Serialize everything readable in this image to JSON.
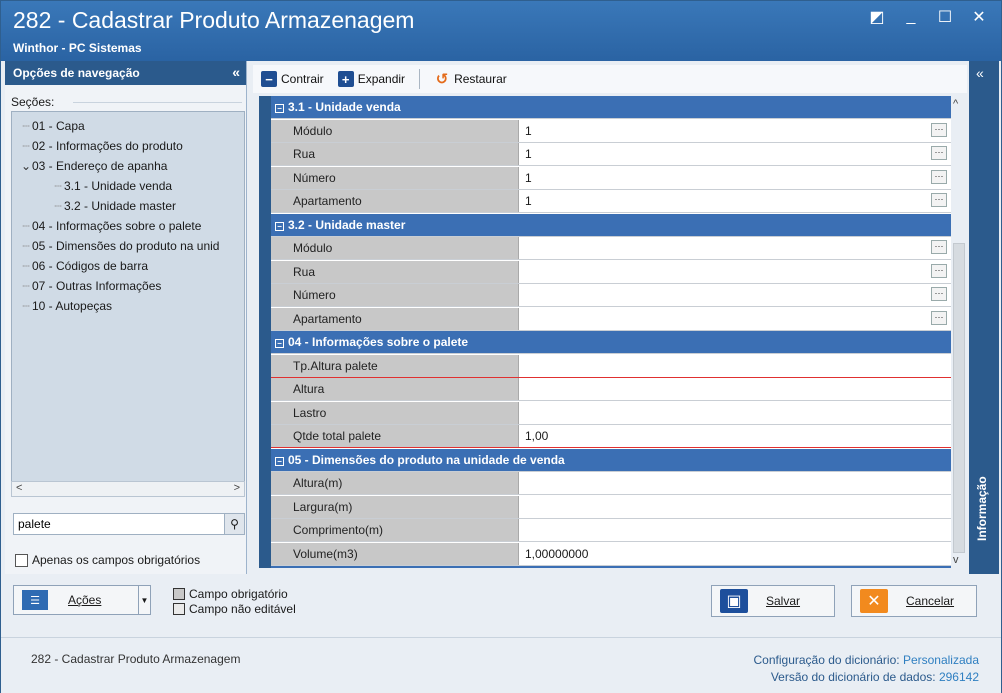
{
  "window": {
    "title": "282 - Cadastrar Produto Armazenagem",
    "subtitle": "Winthor - PC Sistemas",
    "controls": [
      "◩",
      "_",
      "☐",
      "✕"
    ]
  },
  "nav": {
    "header": "Opções de navegação",
    "collapse": "«",
    "sections_label": "Seções:",
    "items": [
      {
        "label": "01 - Capa",
        "indent": 1,
        "toggle": ""
      },
      {
        "label": "02 - Informações do produto",
        "indent": 1,
        "toggle": ""
      },
      {
        "label": "03 - Endereço de apanha",
        "indent": 1,
        "toggle": "⌄"
      },
      {
        "label": "3.1 - Unidade venda",
        "indent": 2,
        "toggle": ""
      },
      {
        "label": "3.2 - Unidade master",
        "indent": 2,
        "toggle": ""
      },
      {
        "label": "04 - Informações sobre o palete",
        "indent": 1,
        "toggle": ""
      },
      {
        "label": "05 - Dimensões do produto na unid",
        "indent": 1,
        "toggle": ""
      },
      {
        "label": "06 - Códigos de barra",
        "indent": 1,
        "toggle": ""
      },
      {
        "label": "07 - Outras Informações",
        "indent": 1,
        "toggle": ""
      },
      {
        "label": "10 - Autopeças",
        "indent": 1,
        "toggle": ""
      }
    ],
    "search_value": "palete",
    "required_only_label": "Apenas os campos obrigatórios"
  },
  "toolbar": {
    "contrair": "Contrair",
    "expandir": "Expandir",
    "restaurar": "Restaurar"
  },
  "grid": {
    "rows": [
      {
        "type": "section",
        "label": "3.1 - Unidade venda"
      },
      {
        "type": "field",
        "label": "Módulo",
        "value": "1",
        "ellipsis": true
      },
      {
        "type": "field",
        "label": "Rua",
        "value": "1",
        "ellipsis": true
      },
      {
        "type": "field",
        "label": "Número",
        "value": "1",
        "ellipsis": true
      },
      {
        "type": "field",
        "label": "Apartamento",
        "value": "1",
        "ellipsis": true
      },
      {
        "type": "section",
        "label": "3.2 - Unidade master"
      },
      {
        "type": "field",
        "label": "Módulo",
        "value": "",
        "ellipsis": true
      },
      {
        "type": "field",
        "label": "Rua",
        "value": "",
        "ellipsis": true
      },
      {
        "type": "field",
        "label": "Número",
        "value": "",
        "ellipsis": true
      },
      {
        "type": "field",
        "label": "Apartamento",
        "value": "",
        "ellipsis": true
      },
      {
        "type": "section",
        "label": "04 - Informações sobre o palete"
      },
      {
        "type": "field",
        "label": "Tp.Altura palete",
        "value": "",
        "ellipsis": false,
        "highlight": true
      },
      {
        "type": "field",
        "label": "Altura",
        "value": "",
        "ellipsis": false
      },
      {
        "type": "field",
        "label": "Lastro",
        "value": "",
        "ellipsis": false
      },
      {
        "type": "field",
        "label": "Qtde total palete",
        "value": "1,00",
        "ellipsis": false,
        "highlight": true
      },
      {
        "type": "section",
        "label": "05 - Dimensões do produto na unidade de venda"
      },
      {
        "type": "field",
        "label": "Altura(m)",
        "value": "",
        "ellipsis": false
      },
      {
        "type": "field",
        "label": "Largura(m)",
        "value": "",
        "ellipsis": false
      },
      {
        "type": "field",
        "label": "Comprimento(m)",
        "value": "",
        "ellipsis": false
      },
      {
        "type": "field",
        "label": "Volume(m3)",
        "value": "1,00000000",
        "ellipsis": false
      },
      {
        "type": "section",
        "label": "06 - Códigos de barra"
      }
    ]
  },
  "info_panel": {
    "label": "Informação",
    "collapse": "«"
  },
  "bottom": {
    "acoes_label": "Ações",
    "legend_required": "Campo obrigatório",
    "legend_readonly": "Campo não editável",
    "salvar_label": "Salvar",
    "cancelar_label": "Cancelar"
  },
  "status": {
    "left": "282 - Cadastrar Produto Armazenagem",
    "config_label": "Configuração do dicionário:",
    "config_value": "Personalizada",
    "version_label": "Versão do dicionário de dados:",
    "version_value": "296142"
  },
  "colors": {
    "titlebar": "#2a63a3",
    "section": "#3b6fb4",
    "highlight_border": "#e03030",
    "cancel_icon": "#f28a1e",
    "save_icon": "#1d4f9c"
  }
}
